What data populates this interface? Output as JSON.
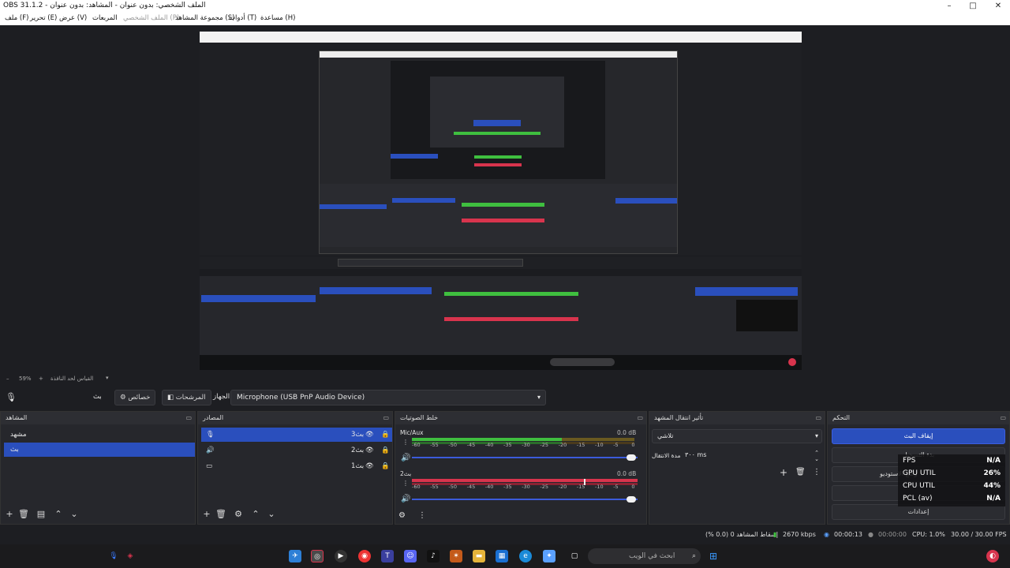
{
  "window": {
    "title": "OBS 31.1.2 - الملف الشخصي: بدون عنوان - المشاهد: بدون عنوان",
    "minimize": "–",
    "maximize": "□",
    "close": "✕"
  },
  "menu": {
    "file": "ملف (F)",
    "edit": "تحرير (E)",
    "view": "عرض (V)",
    "docks": "المربعات",
    "profile": "الملف الشخصي (P)",
    "scene_collection": "مجموعة المشاهد (S)",
    "tools": "أدوات (T)",
    "help": "مساعدة (H)"
  },
  "preview": {
    "zoom_level": "59%",
    "zoom_minus": "–",
    "zoom_plus": "+",
    "zoom_mode": "القياس لحد النافذة",
    "zoom_dropdown": "▾"
  },
  "source_toolbar": {
    "mic_icon": "mic-icon",
    "mute_label": "بث",
    "properties_label": "خصائص",
    "filters_label": "المرشحات",
    "device_label": "الجهاز",
    "device_value": "Microphone (USB PnP Audio Device)"
  },
  "docks": {
    "scenes": {
      "title": "المشاهد",
      "items": [
        "مشهد",
        "بث"
      ],
      "selected_index": 1
    },
    "sources": {
      "title": "المصادر",
      "items": [
        {
          "name": "بث3",
          "icon": "mic-icon"
        },
        {
          "name": "بث2",
          "icon": "speaker-icon"
        },
        {
          "name": "بث1",
          "icon": "monitor-icon"
        }
      ],
      "selected_index": 0
    },
    "mixer": {
      "title": "خلط الصوتيات",
      "channels": [
        {
          "name": "Mic/Aux",
          "db": "0.0 dB"
        },
        {
          "name": "بث2",
          "db": "0.0 dB"
        }
      ],
      "ticks": [
        "-60",
        "-55",
        "-50",
        "-45",
        "-40",
        "-35",
        "-30",
        "-25",
        "-20",
        "-15",
        "-10",
        "-5",
        "0"
      ]
    },
    "transitions": {
      "title": "تأثير انتقال المشهد",
      "transition": "تلاشي",
      "duration_label": "مدة الانتقال",
      "duration_value": "٣٠٠ ms"
    },
    "controls": {
      "title": "التحكم",
      "stop_stream": "إيقاف البث",
      "start_recording": "بدء التسجيل",
      "virtual_camera": "وضع الاستوديو",
      "studio_mode": "",
      "settings": "إعدادات"
    }
  },
  "stats_overlay": {
    "rows": [
      {
        "key": "FPS",
        "value": "N/A"
      },
      {
        "key": "GPU UTIL",
        "value": "26%"
      },
      {
        "key": "CPU UTIL",
        "value": "44%"
      },
      {
        "key": "PCL (av)",
        "value": "N/A"
      }
    ]
  },
  "statusbar": {
    "dropped": "إسقاط المشاهد 0 (0.0 %)",
    "bitrate": "2670 kbps",
    "stream_time": "00:00:13",
    "rec_time": "00:00:00",
    "cpu": "CPU: 1.0%",
    "fps": "30.00 / 30.00 FPS"
  },
  "taskbar": {
    "search_placeholder": "ابحث في الويب"
  },
  "colors": {
    "accent": "#2a4fbd",
    "meter_green": "#3fbf3f",
    "meter_yellow": "#c9b42a",
    "meter_red": "#d8344d",
    "bg": "#1d1e22"
  }
}
